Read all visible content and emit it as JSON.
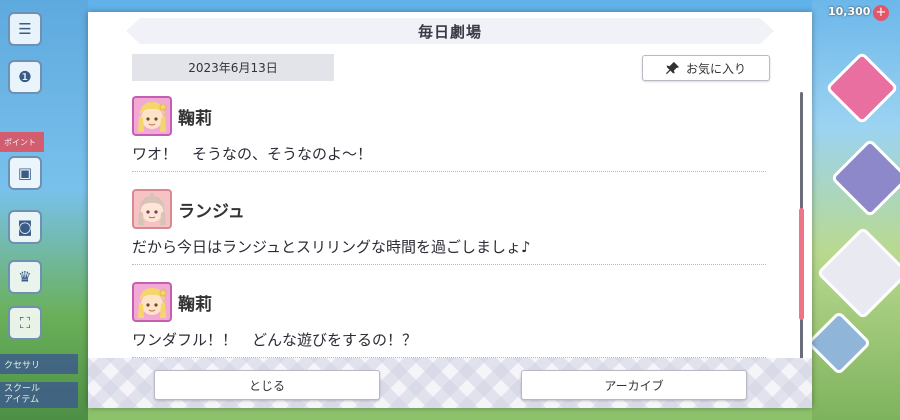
{
  "background": {
    "top_counter": "10,300",
    "side_banner_1": "クセサリ",
    "side_banner_2": "スクール\nアイテム",
    "side_label_red": "ポイント"
  },
  "dialog": {
    "title": "毎日劇場",
    "date": "2023年6月13日",
    "favorite_label": "お気に入り",
    "entries": [
      {
        "speaker": "鞠莉",
        "text": "ワオ！　そうなの、そうなのよ～！"
      },
      {
        "speaker": "ランジュ",
        "text": "だから今日はランジュとスリリングな時間を過ごしましょ♪"
      },
      {
        "speaker": "鞠莉",
        "text": "ワンダフル！！　どんな遊びをするの！？"
      }
    ],
    "close_label": "とじる",
    "archive_label": "アーカイブ"
  },
  "colors": {
    "accent_scroll": "#ee7486",
    "title_bg": "#f1f2f8"
  }
}
